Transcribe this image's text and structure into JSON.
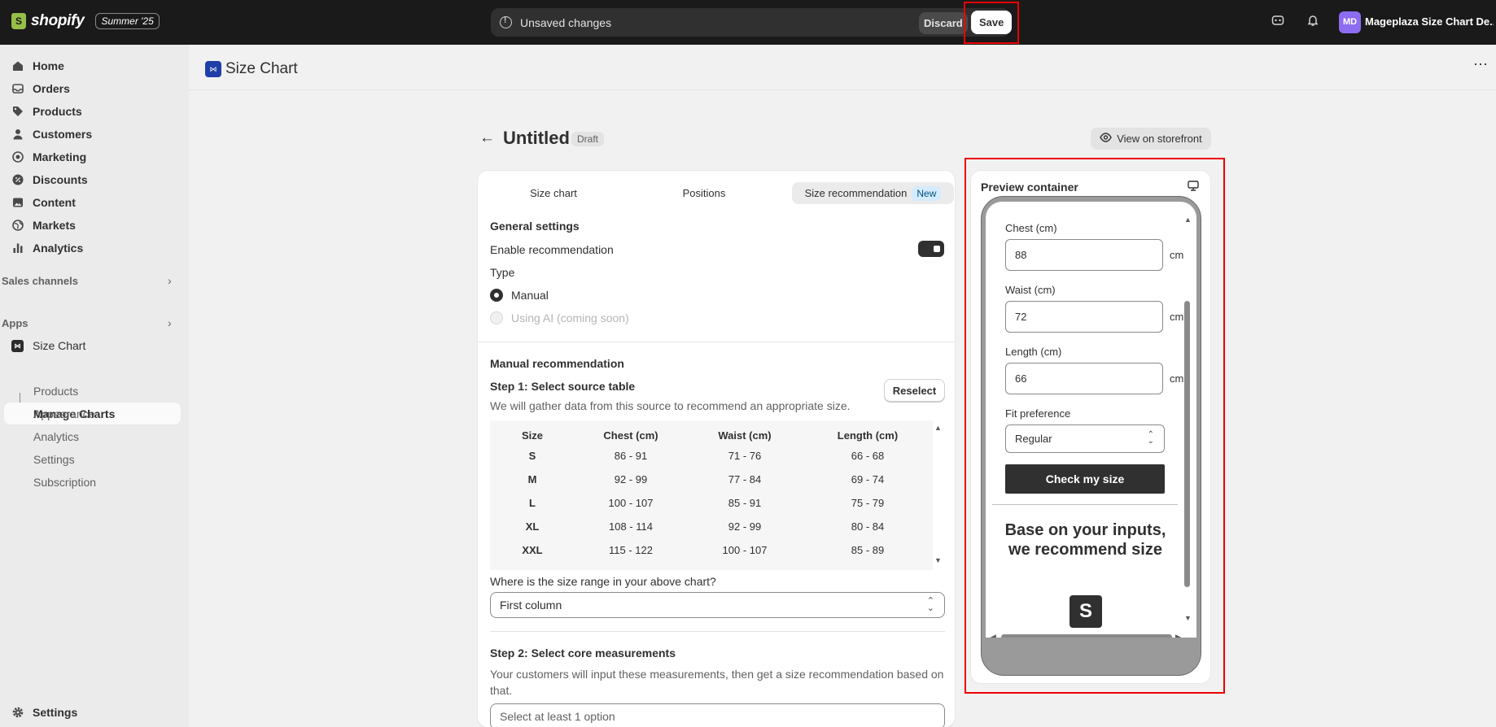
{
  "topbar": {
    "brand": "shopify",
    "edition_badge": "Summer '25",
    "unsaved_text": "Unsaved changes",
    "discard_label": "Discard",
    "save_label": "Save",
    "store_initials": "MD",
    "store_name": "Mageplaza Size Chart De..."
  },
  "sidebar": {
    "items": [
      {
        "label": "Home",
        "icon": "home-icon"
      },
      {
        "label": "Orders",
        "icon": "inbox-icon"
      },
      {
        "label": "Products",
        "icon": "tag-icon"
      },
      {
        "label": "Customers",
        "icon": "person-icon"
      },
      {
        "label": "Marketing",
        "icon": "target-icon"
      },
      {
        "label": "Discounts",
        "icon": "discount-icon"
      },
      {
        "label": "Content",
        "icon": "image-icon"
      },
      {
        "label": "Markets",
        "icon": "globe-icon"
      },
      {
        "label": "Analytics",
        "icon": "bar-chart-icon"
      }
    ],
    "sales_channels_label": "Sales channels",
    "apps_label": "Apps",
    "app_name": "Size Chart",
    "app_subitems": [
      "Manage Charts",
      "Products",
      "Appearance",
      "Analytics",
      "Settings",
      "Subscription"
    ],
    "settings_label": "Settings"
  },
  "page_header": {
    "app_title": "Size Chart",
    "more_icon": "ellipsis-icon"
  },
  "title_row": {
    "title": "Untitled",
    "status": "Draft",
    "storefront_label": "View on storefront"
  },
  "tabs": [
    {
      "label": "Size chart"
    },
    {
      "label": "Positions"
    },
    {
      "label": "Size recommendation",
      "badge": "New",
      "active": true
    }
  ],
  "general": {
    "heading": "General settings",
    "enable_label": "Enable recommendation",
    "enable_on": true,
    "type_label": "Type",
    "option_manual": "Manual",
    "option_ai": "Using AI (coming soon)"
  },
  "manual": {
    "heading": "Manual recommendation",
    "step1_title": "Step 1: Select source table",
    "reselect_label": "Reselect",
    "step1_desc": "We will gather data from this source to recommend an appropriate size.",
    "table": {
      "headers": [
        "Size",
        "Chest (cm)",
        "Waist (cm)",
        "Length (cm)"
      ],
      "rows": [
        [
          "S",
          "86 - 91",
          "71 - 76",
          "66 - 68"
        ],
        [
          "M",
          "92 - 99",
          "77 - 84",
          "69 - 74"
        ],
        [
          "L",
          "100 - 107",
          "85 - 91",
          "75 - 79"
        ],
        [
          "XL",
          "108 - 114",
          "92 - 99",
          "80 - 84"
        ],
        [
          "XXL",
          "115 - 122",
          "100 - 107",
          "85 - 89"
        ]
      ]
    },
    "range_question": "Where is the size range in your above chart?",
    "range_value": "First column",
    "step2_title": "Step 2: Select core measurements",
    "step2_desc": "Your customers will input these measurements, then get a size recommendation based on that.",
    "step2_placeholder": "Select at least 1 option"
  },
  "preview": {
    "title": "Preview container",
    "device_icon": "monitor-icon",
    "fields": [
      {
        "label": "Chest (cm)",
        "value": "88",
        "unit": "cm"
      },
      {
        "label": "Waist (cm)",
        "value": "72",
        "unit": "cm"
      },
      {
        "label": "Length (cm)",
        "value": "66",
        "unit": "cm"
      }
    ],
    "fit_label": "Fit preference",
    "fit_value": "Regular",
    "check_button": "Check my size",
    "result_text": "Base on your inputs, we recommend size",
    "result_size": "S"
  }
}
